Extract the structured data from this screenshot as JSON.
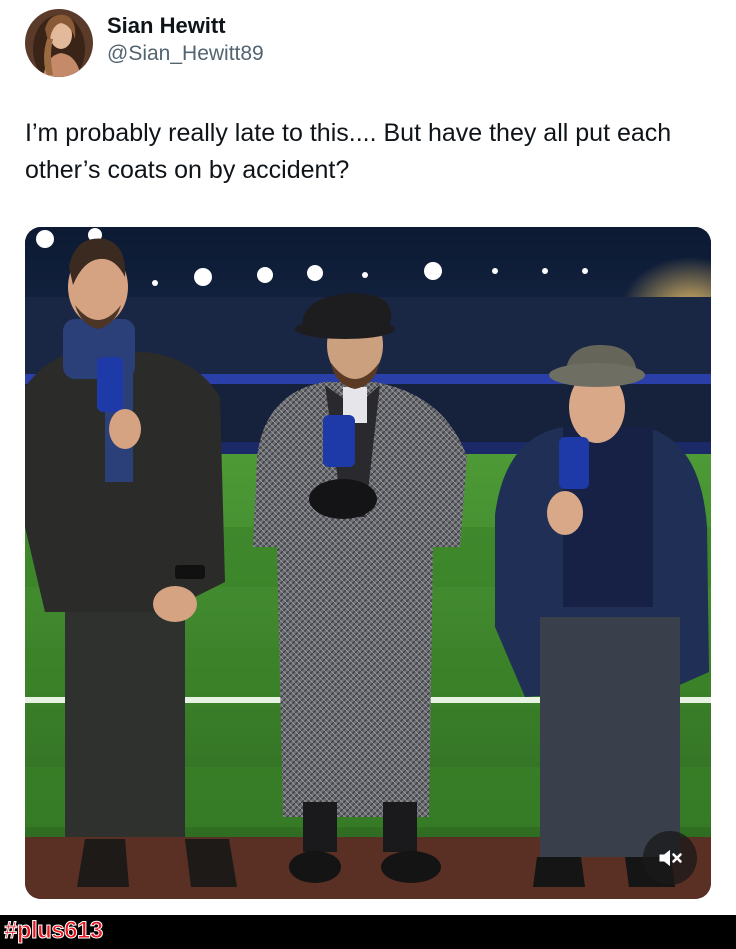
{
  "author": {
    "display_name": "Sian Hewitt",
    "handle": "@Sian_Hewitt89",
    "avatar_icon": "profile-photo"
  },
  "tweet": {
    "text": "I’m probably really late to this.... But have they all put each other’s coats on by accident?"
  },
  "media": {
    "type": "photo",
    "mute_icon": "speaker-muted-icon"
  },
  "watermark": {
    "text": "#plus613",
    "color": "#e8141e"
  },
  "colors": {
    "text_primary": "#0f1419",
    "text_secondary": "#536471",
    "pitch_green": "#3f8a2e"
  }
}
